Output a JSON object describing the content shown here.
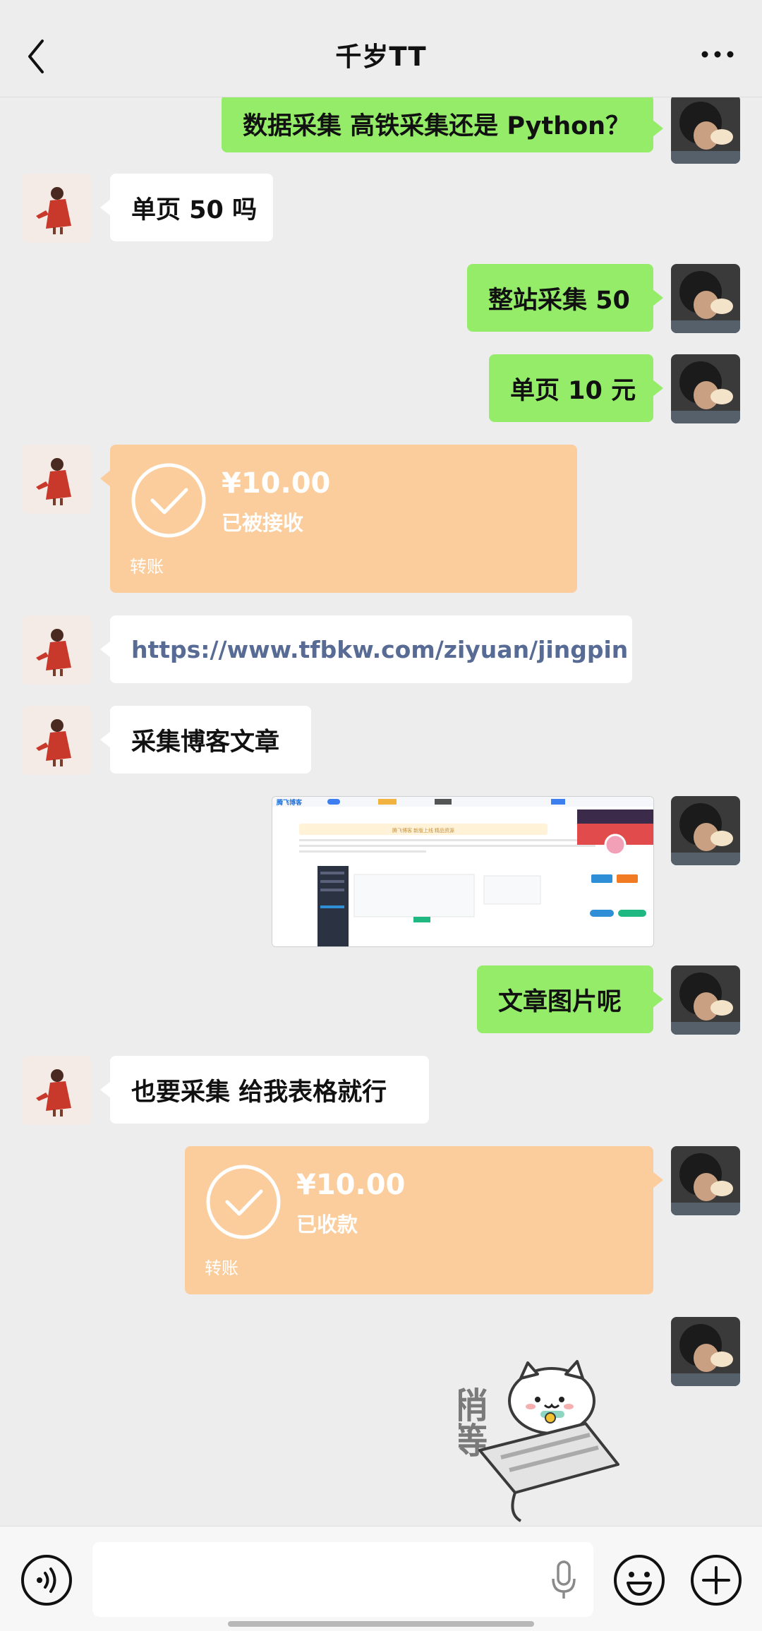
{
  "header": {
    "title": "千岁TT"
  },
  "messages": [
    {
      "side": "right",
      "type": "text",
      "text": "数据采集 高铁采集还是 Python？"
    },
    {
      "side": "left",
      "type": "text",
      "text": "单页 50 吗"
    },
    {
      "side": "right",
      "type": "text",
      "text": "整站采集 50"
    },
    {
      "side": "right",
      "type": "text",
      "text": "单页 10 元"
    },
    {
      "side": "left",
      "type": "transfer",
      "amount": "¥10.00",
      "status": "已被接收",
      "label": "转账"
    },
    {
      "side": "left",
      "type": "link",
      "text": "https://www.tfbkw.com/ziyuan/jingpin"
    },
    {
      "side": "left",
      "type": "text",
      "text": "采集博客文章"
    },
    {
      "side": "right",
      "type": "image",
      "preview": {
        "site": "腾飞博客",
        "banner": "腾飞博客 新版上线 精品资源"
      }
    },
    {
      "side": "right",
      "type": "text",
      "text": "文章图片呢"
    },
    {
      "side": "left",
      "type": "text",
      "text": "也要采集 给我表格就行"
    },
    {
      "side": "right",
      "type": "transfer",
      "amount": "¥10.00",
      "status": "已收款",
      "label": "转账"
    },
    {
      "side": "right",
      "type": "sticker",
      "caption": "稍等"
    }
  ],
  "colors": {
    "self_bubble": "#95ec69",
    "other_bubble": "#ffffff",
    "transfer": "#fbcd9c",
    "link": "#576b95",
    "background": "#ededed"
  },
  "icons": {
    "back": "chevron-left-icon",
    "more": "more-dots-icon",
    "voice": "voice-icon",
    "mic": "microphone-icon",
    "emoji": "emoji-icon",
    "plus": "plus-icon"
  }
}
